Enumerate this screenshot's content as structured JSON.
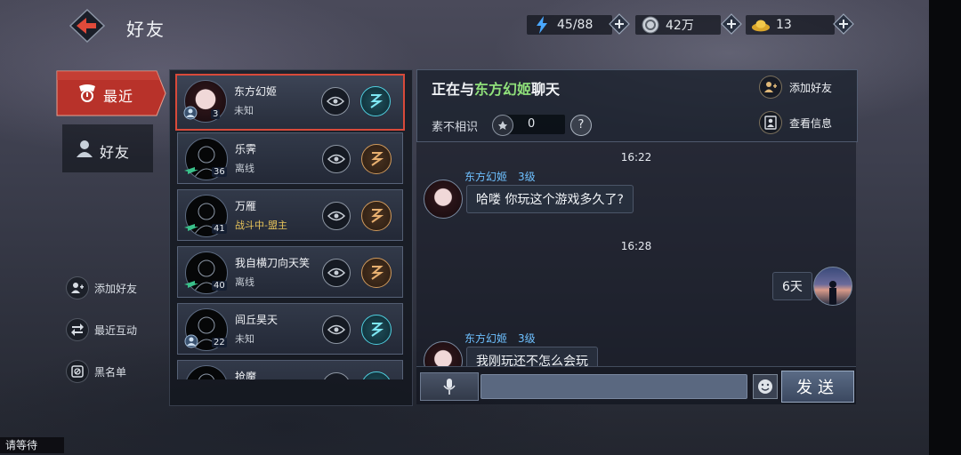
{
  "header": {
    "title": "好友"
  },
  "resources": {
    "stamina": {
      "value": "45/88",
      "icon": "lightning-icon",
      "color": "#4aa8ff"
    },
    "coins": {
      "value": "42万",
      "icon": "coin-icon"
    },
    "ingots": {
      "value": "13",
      "icon": "gold-ingot-icon"
    }
  },
  "tabs": {
    "recent": "最近",
    "friends": "好友"
  },
  "side_actions": {
    "add_friend": "添加好友",
    "recent_interact": "最近互动",
    "blacklist": "黑名单"
  },
  "friends": [
    {
      "name": "东方幻姬",
      "status": "未知",
      "level": "3",
      "selected": true,
      "action": "teal"
    },
    {
      "name": "乐霁",
      "status": "离线",
      "level": "36",
      "action": "orange"
    },
    {
      "name": "万雁",
      "status": "战斗中-盟主",
      "level": "41",
      "action": "orange",
      "gold": true
    },
    {
      "name": "我自横刀向天笑",
      "status": "离线",
      "level": "40",
      "action": "orange"
    },
    {
      "name": "闾丘昊天",
      "status": "未知",
      "level": "22",
      "action": "teal"
    },
    {
      "name": "抢魔",
      "status": "",
      "level": "",
      "action": "teal"
    }
  ],
  "chat": {
    "title_prefix": "正在与",
    "title_name": "东方幻姬",
    "title_suffix": "聊天",
    "intimacy_label": "素不相识",
    "intimacy_value": "0",
    "help": "?",
    "add_friend": "添加好友",
    "view_info": "查看信息",
    "messages": {
      "t1": "16:22",
      "m1_name": "东方幻姬　3级",
      "m1_text": "哈喽 你玩这个游戏多久了?",
      "t2": "16:28",
      "m2_text": "6天",
      "m3_name": "东方幻姬　3级",
      "m3_text": "我刚玩还不怎么会玩"
    },
    "send": "发送"
  },
  "status_bar": {
    "waiting": "请等待"
  },
  "colors": {
    "accent_red": "#d94a3a",
    "highlight_green": "#8fe07a",
    "name_blue": "#6ec0ff",
    "gold": "#e8c45a"
  }
}
